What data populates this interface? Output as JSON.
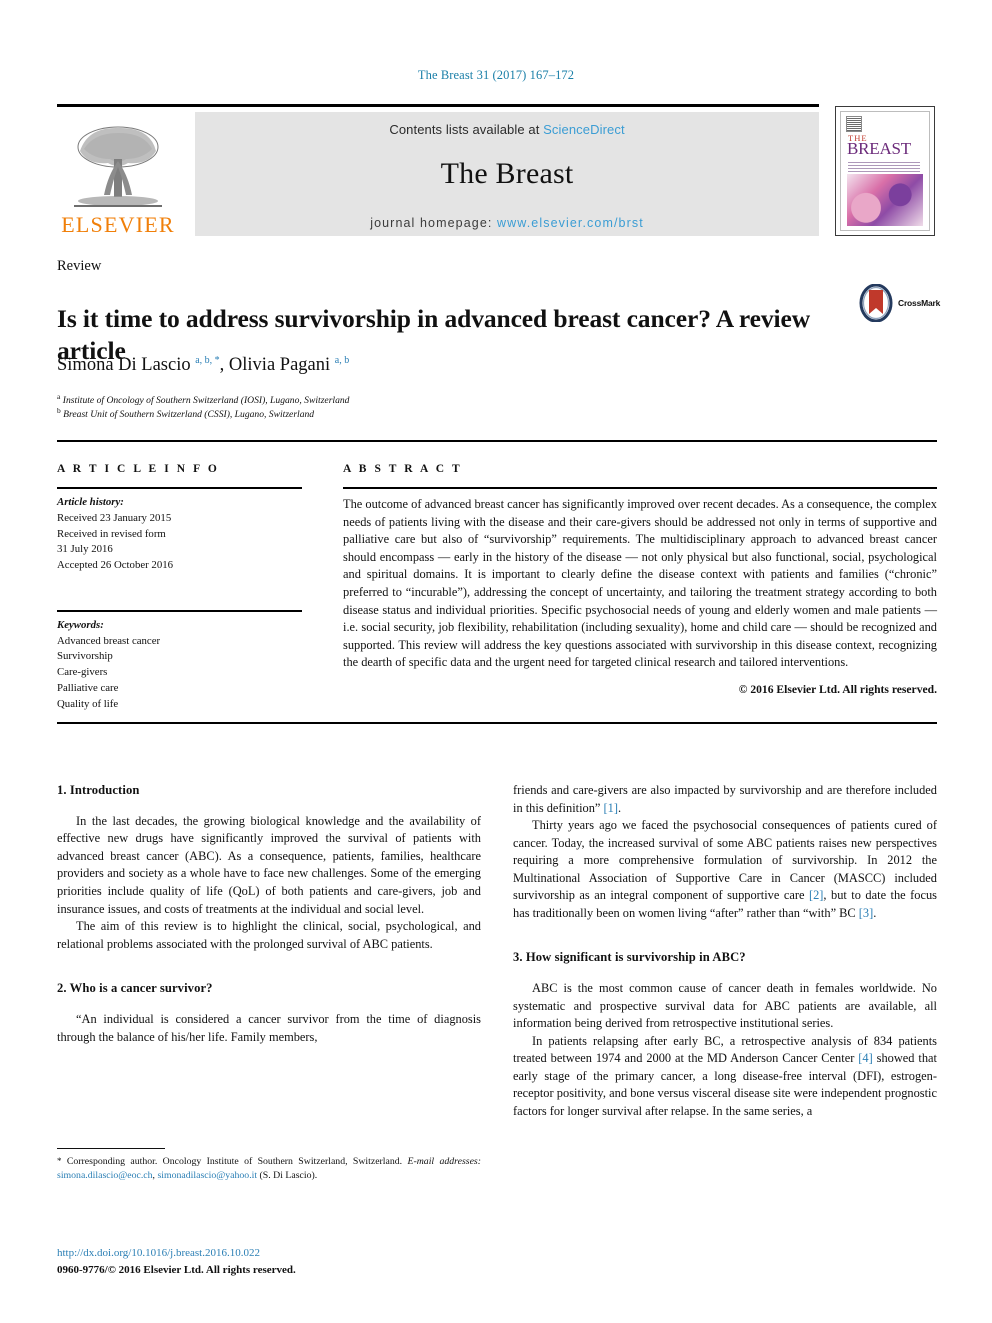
{
  "running_head": "The Breast 31 (2017) 167–172",
  "masthead": {
    "contents_prefix": "Contents lists available at ",
    "sciencedirect": "ScienceDirect",
    "journal_name": "The Breast",
    "homepage_prefix": "journal homepage: ",
    "homepage_url": "www.elsevier.com/brst",
    "publisher": "ELSEVIER",
    "cover_the": "THE",
    "cover_title": "BREAST",
    "link_color": "#3b9dd4",
    "publisher_color": "#f07f09"
  },
  "article": {
    "type": "Review",
    "title": "Is it time to address survivorship in advanced breast cancer? A review article",
    "authors_html": "Simona Di Lascio <sup>a, b, *</sup>, Olivia Pagani <sup>a, b</sup>",
    "affiliation_a": "Institute of Oncology of Southern Switzerland (IOSI), Lugano, Switzerland",
    "affiliation_b": "Breast Unit of Southern Switzerland (CSSI), Lugano, Switzerland",
    "crossmark_label": "CrossMark"
  },
  "info": {
    "heading": "A R T I C L E  I N F O",
    "history_label": "Article history:",
    "history_lines": [
      "Received 23 January 2015",
      "Received in revised form",
      "31 July 2016",
      "Accepted 26 October 2016"
    ],
    "keywords_label": "Keywords:",
    "keywords": [
      "Advanced breast cancer",
      "Survivorship",
      "Care-givers",
      "Palliative care",
      "Quality of life"
    ]
  },
  "abstract": {
    "heading": "A B S T R A C T",
    "text": "The outcome of advanced breast cancer has significantly improved over recent decades. As a consequence, the complex needs of patients living with the disease and their care-givers should be addressed not only in terms of supportive and palliative care but also of “survivorship” requirements. The multidisciplinary approach to advanced breast cancer should encompass — early in the history of the disease — not only physical but also functional, social, psychological and spiritual domains. It is important to clearly define the disease context with patients and families (“chronic” preferred to “incurable”), addressing the concept of uncertainty, and tailoring the treatment strategy according to both disease status and individual priorities. Specific psychosocial needs of young and elderly women and male patients — i.e. social security, job flexibility, rehabilitation (including sexuality), home and child care — should be recognized and supported. This review will address the key questions associated with survivorship in this disease context, recognizing the dearth of specific data and the urgent need for targeted clinical research and tailored interventions.",
    "copyright": "© 2016 Elsevier Ltd. All rights reserved."
  },
  "body": {
    "left": {
      "h1": "1. Introduction",
      "p1": "In the last decades, the growing biological knowledge and the availability of effective new drugs have significantly improved the survival of patients with advanced breast cancer (ABC). As a consequence, patients, families, healthcare providers and society as a whole have to face new challenges. Some of the emerging priorities include quality of life (QoL) of both patients and care-givers, job and insurance issues, and costs of treatments at the individual and social level.",
      "p2": "The aim of this review is to highlight the clinical, social, psychological, and relational problems associated with the prolonged survival of ABC patients.",
      "h2": "2. Who is a cancer survivor?",
      "p3": "“An individual is considered a cancer survivor from the time of diagnosis through the balance of his/her life. Family members,"
    },
    "right": {
      "p1_part1": "friends and care-givers are also impacted by survivorship and are therefore included in this definition” ",
      "p1_ref": "[1]",
      "p1_end": ".",
      "p2_part1": "Thirty years ago we faced the psychosocial consequences of patients cured of cancer. Today, the increased survival of some ABC patients raises new perspectives requiring a more comprehensive formulation of survivorship. In 2012 the Multinational Association of Supportive Care in Cancer (MASCC) included survivorship as an integral component of supportive care ",
      "p2_ref1": "[2]",
      "p2_part2": ", but to date the focus has traditionally been on women living “after” rather than “with” BC ",
      "p2_ref2": "[3]",
      "p2_end": ".",
      "h3": "3. How significant is survivorship in ABC?",
      "p3": "ABC is the most common cause of cancer death in females worldwide. No systematic and prospective survival data for ABC patients are available, all information being derived from retrospective institutional series.",
      "p4_part1": "In patients relapsing after early BC, a retrospective analysis of 834 patients treated between 1974 and 2000 at the MD Anderson Cancer Center ",
      "p4_ref": "[4]",
      "p4_part2": " showed that early stage of the primary cancer, a long disease-free interval (DFI), estrogen-receptor positivity, and bone versus visceral disease site were independent prognostic factors for longer survival after relapse. In the same series, a"
    }
  },
  "footnote": {
    "star": "*",
    "corresponding": " Corresponding author. Oncology Institute of Southern Switzerland, Switzerland.",
    "email_label": "E-mail addresses:",
    "email1": "simona.dilascio@eoc.ch",
    "email_sep": ", ",
    "email2": "simonadilascio@yahoo.it",
    "email_attrib": " (S. Di Lascio)."
  },
  "doi": {
    "url": "http://dx.doi.org/10.1016/j.breast.2016.10.022",
    "issn_line": "0960-9776/© 2016 Elsevier Ltd. All rights reserved."
  }
}
